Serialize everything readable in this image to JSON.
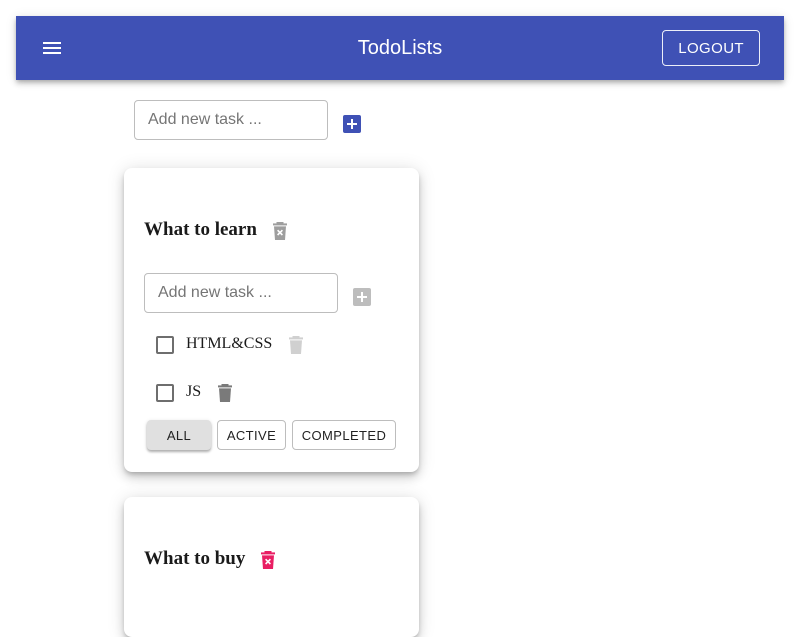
{
  "header": {
    "title": "TodoLists",
    "menu_icon": "hamburger-menu-icon",
    "logout_label": "LOGOUT",
    "color": "#3f51b5"
  },
  "new_list": {
    "placeholder": "Add new task ...",
    "add_icon": "add-box-icon",
    "add_color": "#3f51b5"
  },
  "todolists": [
    {
      "title": "What to learn",
      "delete_icon": "delete-forever-icon",
      "delete_icon_color": "#9e9e9e",
      "input_placeholder": "Add new task ...",
      "add_icon_color": "#bdbdbd",
      "tasks": [
        {
          "title": "HTML&CSS",
          "done": false,
          "delete_icon_color": "#d0d0d0"
        },
        {
          "title": "JS",
          "done": false,
          "delete_icon_color": "#7a7a7a"
        }
      ],
      "filters": [
        {
          "label": "ALL",
          "selected": true
        },
        {
          "label": "ACTIVE",
          "selected": false
        },
        {
          "label": "COMPLETED",
          "selected": false
        }
      ]
    },
    {
      "title": "What to buy",
      "delete_icon": "delete-forever-icon",
      "delete_icon_color": "#e91e63"
    }
  ]
}
